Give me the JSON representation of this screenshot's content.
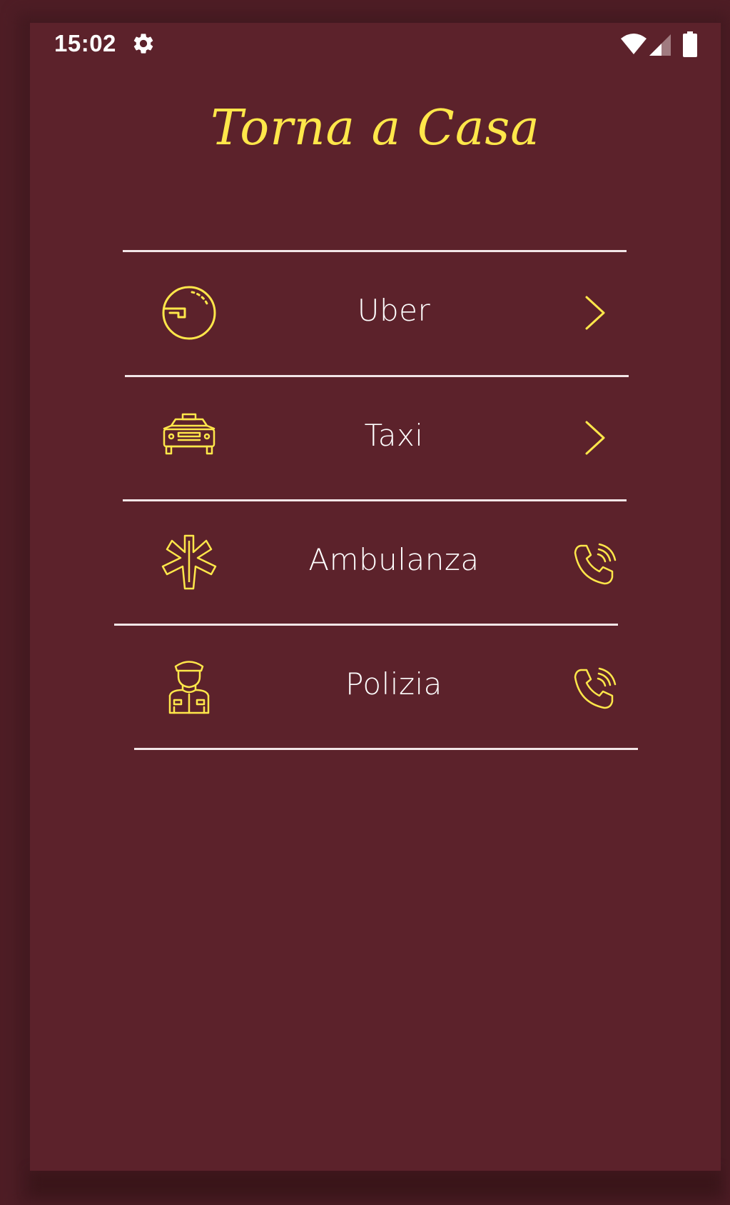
{
  "status_bar": {
    "time": "15:02",
    "icons": [
      "gear-icon",
      "wifi-icon",
      "signal-icon",
      "battery-icon"
    ]
  },
  "app": {
    "title": "Torna a Casa"
  },
  "colors": {
    "background": "#5c222b",
    "accent": "#ffe74a",
    "text": "#ffffff",
    "divider": "#f2e6e7"
  },
  "services": [
    {
      "label": "Uber",
      "icon": "uber-icon",
      "action": "chevron-right-icon"
    },
    {
      "label": "Taxi",
      "icon": "taxi-icon",
      "action": "chevron-right-icon"
    },
    {
      "label": "Ambulanza",
      "icon": "star-of-life-icon",
      "action": "phone-icon"
    },
    {
      "label": "Polizia",
      "icon": "police-officer-icon",
      "action": "phone-icon"
    }
  ]
}
